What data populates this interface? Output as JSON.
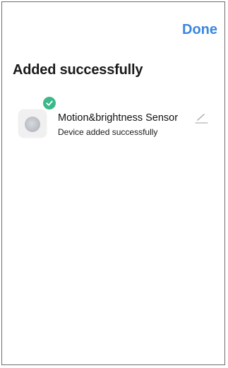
{
  "header": {
    "done_label": "Done"
  },
  "main": {
    "title": "Added successfully",
    "device": {
      "name": "Motion&brightness Sensor",
      "status": "Device added successfully",
      "badge_icon": "check-circle-icon",
      "edit_icon": "pencil-icon"
    }
  },
  "colors": {
    "accent": "#3a86e0",
    "success": "#3bb98b"
  }
}
